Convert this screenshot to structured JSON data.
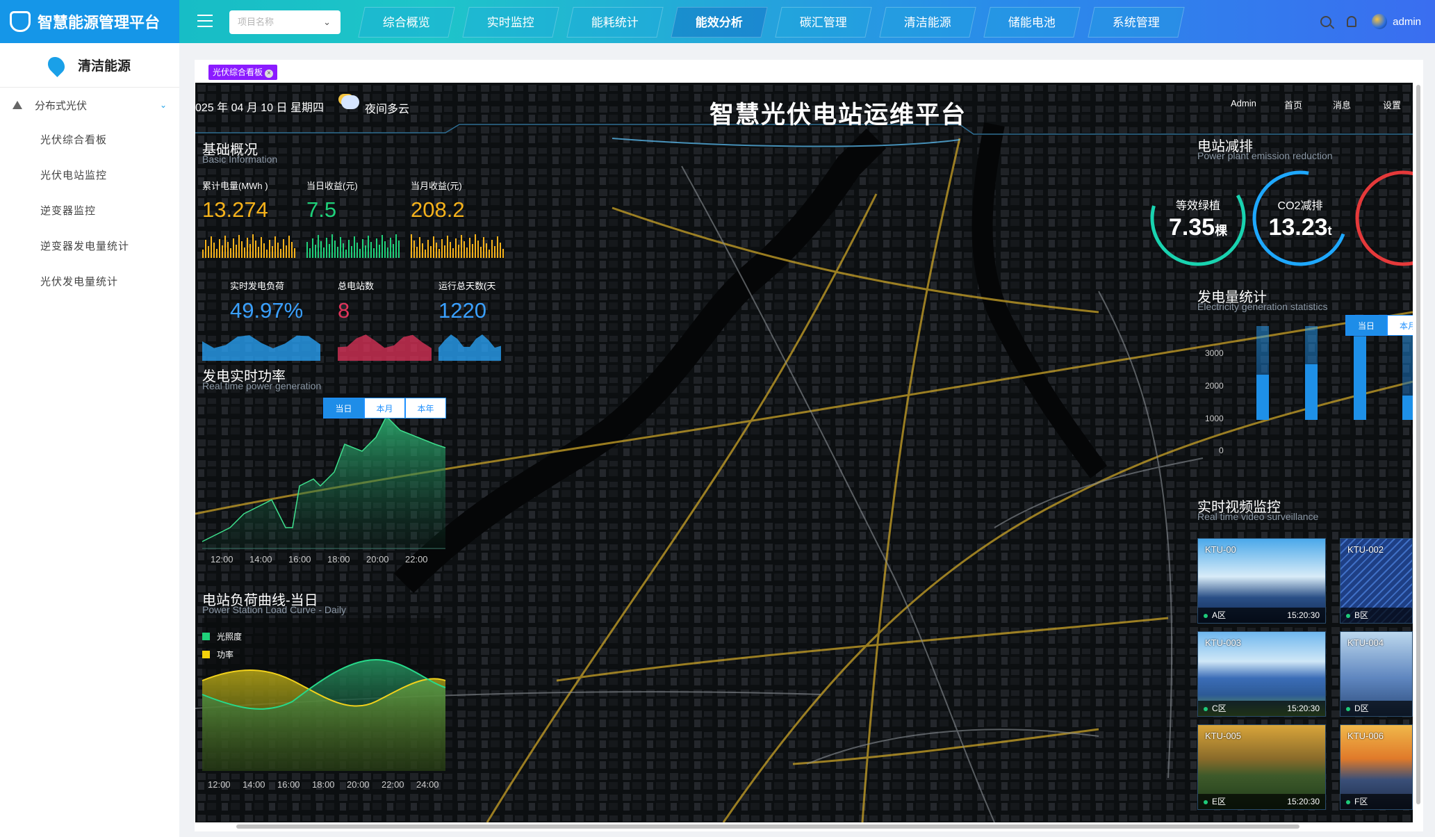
{
  "app": {
    "title": "智慧能源管理平台"
  },
  "topbar": {
    "project_placeholder": "项目名称",
    "nav": [
      "综合概览",
      "实时监控",
      "能耗统计",
      "能效分析",
      "碳汇管理",
      "清洁能源",
      "储能电池",
      "系统管理"
    ],
    "active_nav": "能效分析",
    "user": "admin"
  },
  "sidebar": {
    "header": "清洁能源",
    "group": "分布式光伏",
    "items": [
      "光伏综合看板",
      "光伏电站监控",
      "逆变器监控",
      "逆变器发电量统计",
      "光伏发电量统计"
    ]
  },
  "tabs": {
    "active": "光伏综合看板"
  },
  "dashboard": {
    "date": "025 年 04 月 10 日   星期四",
    "weather": "夜间多云",
    "title": "智慧光伏电站运维平台",
    "top_links": [
      "Admin",
      "首页",
      "消息",
      "设置"
    ],
    "basic": {
      "title": "基础概况",
      "subtitle": "Basic Information",
      "kpis_row1": [
        {
          "label": "累计电量(MWh )",
          "value": "13.274",
          "color": "#f5b21b"
        },
        {
          "label": "当日收益(元)",
          "value": "7.5",
          "color": "#1fd17a"
        },
        {
          "label": "当月收益(元)",
          "value": "208.2",
          "color": "#f5b21b"
        }
      ],
      "kpis_row2": [
        {
          "label": "实时发电负荷",
          "value": "49.97%",
          "color": "#3aa0ff"
        },
        {
          "label": "总电站数",
          "value": "8",
          "color": "#e0335a"
        },
        {
          "label": "运行总天数(天",
          "value": "1220",
          "color": "#3aa0ff"
        }
      ]
    },
    "power": {
      "title": "发电实时功率",
      "subtitle": "Real time power generation",
      "buttons": [
        "当日",
        "本月",
        "本年"
      ],
      "x_ticks": [
        "12:00",
        "14:00",
        "16:00",
        "18:00",
        "20:00",
        "22:00"
      ]
    },
    "load": {
      "title": "电站负荷曲线-当日",
      "subtitle": "Power Station Load Curve - Daily",
      "legend": [
        {
          "name": "光照度",
          "color": "#1fd17a"
        },
        {
          "name": "功率",
          "color": "#f5d20b"
        }
      ],
      "x_ticks": [
        "12:00",
        "14:00",
        "16:00",
        "18:00",
        "20:00",
        "22:00",
        "24:00"
      ]
    },
    "emission": {
      "title": "电站减排",
      "subtitle": "Power plant emission reduction",
      "rings": [
        {
          "label": "等效绿植",
          "value": "7.35",
          "unit": "棵",
          "color": "#19d3b0"
        },
        {
          "label": "CO2减排",
          "value": "13.23",
          "unit": "t",
          "color": "#1ea8ff"
        }
      ]
    },
    "gen": {
      "title": "发电量统计",
      "subtitle": "Electricity generation statistics",
      "buttons": [
        "当日",
        "本月"
      ],
      "y_ticks": [
        "3000",
        "2000",
        "1000",
        "0"
      ]
    },
    "video": {
      "title": "实时视频监控",
      "subtitle": "Real time video surveillance",
      "cams": [
        {
          "id": "KTU-00",
          "zone": "A区",
          "time": "15:20:30"
        },
        {
          "id": "KTU-002",
          "zone": "B区",
          "time": ""
        },
        {
          "id": "KTU-003",
          "zone": "C区",
          "time": "15:20:30"
        },
        {
          "id": "KTU-004",
          "zone": "D区",
          "time": ""
        },
        {
          "id": "KTU-005",
          "zone": "E区",
          "time": "15:20:30"
        },
        {
          "id": "KTU-006",
          "zone": "F区",
          "time": ""
        }
      ]
    }
  }
}
